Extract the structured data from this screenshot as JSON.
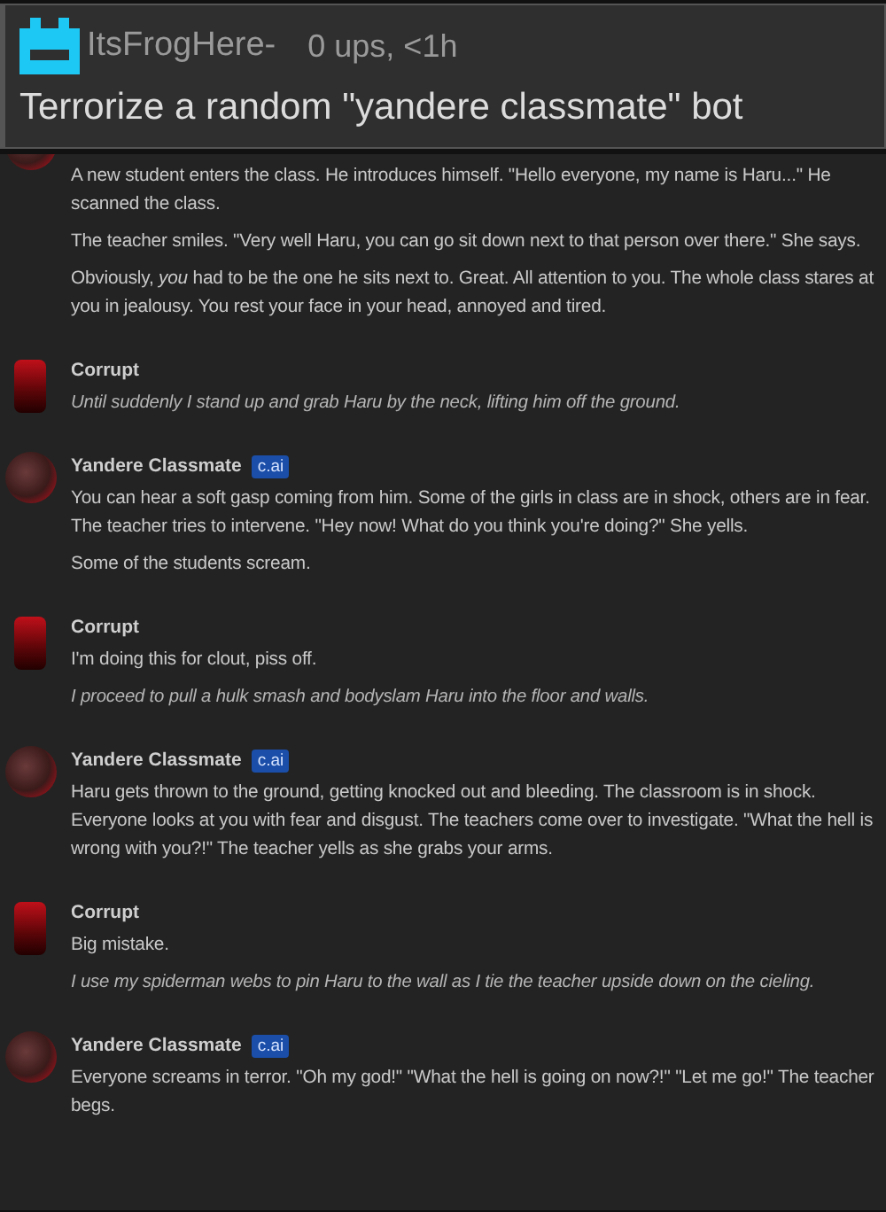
{
  "post": {
    "username": "ItsFrogHere-",
    "meta": "0 ups, <1h",
    "title": "Terrorize a random \"yandere classmate\" bot"
  },
  "messages": [
    {
      "kind": "bot",
      "cut_top": true,
      "paragraphs": [
        {
          "text": "A new student enters the class. He introduces himself. \"Hello everyone, my name is Haru...\" He scanned the class."
        },
        {
          "text": "The teacher smiles. \"Very well Haru, you can go sit down next to that person over there.\" She says."
        },
        {
          "text": "Obviously, *you* had to be the one he sits next to. Great. All attention to you. The whole class stares at you in jealousy. You rest your face in your head, annoyed and tired."
        }
      ]
    },
    {
      "kind": "user",
      "author": "Corrupt",
      "paragraphs": [
        {
          "text": "Until suddenly I stand up and grab Haru by the neck, lifting him off the ground.",
          "italic": true
        }
      ]
    },
    {
      "kind": "bot",
      "author": "Yandere Classmate",
      "badge": "c.ai",
      "paragraphs": [
        {
          "text": "You can hear a soft gasp coming from him. Some of the girls in class are in shock, others are in fear. The teacher tries to intervene. \"Hey now! What do you think you're doing?\" She yells."
        },
        {
          "text": "Some of the students scream."
        }
      ]
    },
    {
      "kind": "user",
      "author": "Corrupt",
      "paragraphs": [
        {
          "text": "I'm doing this for clout, piss off."
        },
        {
          "text": "I proceed to pull a hulk smash and bodyslam Haru into the floor and walls.",
          "italic": true
        }
      ]
    },
    {
      "kind": "bot",
      "author": "Yandere Classmate",
      "badge": "c.ai",
      "paragraphs": [
        {
          "text": "Haru gets thrown to the ground, getting knocked out and bleeding. The classroom is in shock. Everyone looks at you with fear and disgust. The teachers come over to investigate. \"What the hell is wrong with you?!\" The teacher yells as she grabs your arms."
        }
      ]
    },
    {
      "kind": "user",
      "author": "Corrupt",
      "paragraphs": [
        {
          "text": "Big mistake."
        },
        {
          "text": "I use my spiderman webs to pin Haru to the wall as I tie the teacher upside down on the cieling.",
          "italic": true
        }
      ]
    },
    {
      "kind": "bot",
      "author": "Yandere Classmate",
      "badge": "c.ai",
      "paragraphs": [
        {
          "text": "Everyone screams in terror. \"Oh my god!\" \"What the hell is going on now?!\" \"Let me go!\" The teacher begs."
        }
      ]
    }
  ]
}
